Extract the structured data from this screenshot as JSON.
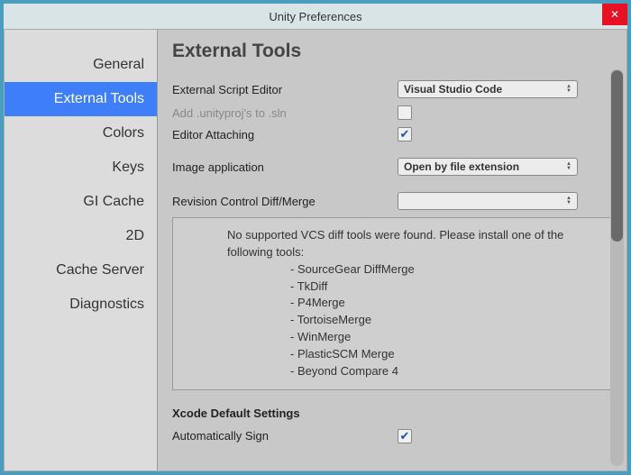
{
  "window": {
    "title": "Unity Preferences"
  },
  "sidebar": {
    "items": [
      {
        "label": "General"
      },
      {
        "label": "External Tools",
        "active": true
      },
      {
        "label": "Colors"
      },
      {
        "label": "Keys"
      },
      {
        "label": "GI Cache"
      },
      {
        "label": "2D"
      },
      {
        "label": "Cache Server"
      },
      {
        "label": "Diagnostics"
      }
    ]
  },
  "content": {
    "heading": "External Tools",
    "rows": {
      "script_editor_label": "External Script Editor",
      "script_editor_value": "Visual Studio Code",
      "add_unityproj_label": "Add .unityproj's to .sln",
      "add_unityproj_checked": false,
      "editor_attaching_label": "Editor Attaching",
      "editor_attaching_checked": true,
      "image_app_label": "Image application",
      "image_app_value": "Open by file extension",
      "diff_merge_label": "Revision Control Diff/Merge",
      "diff_merge_value": ""
    },
    "vcs_info": {
      "intro": "No supported VCS diff tools were found. Please install one of the following tools:",
      "tools": [
        "- SourceGear DiffMerge",
        "- TkDiff",
        "- P4Merge",
        "- TortoiseMerge",
        "- WinMerge",
        "- PlasticSCM Merge",
        "- Beyond Compare 4"
      ]
    },
    "xcode": {
      "header": "Xcode Default Settings",
      "auto_sign_label": "Automatically Sign",
      "auto_sign_checked": true
    }
  }
}
